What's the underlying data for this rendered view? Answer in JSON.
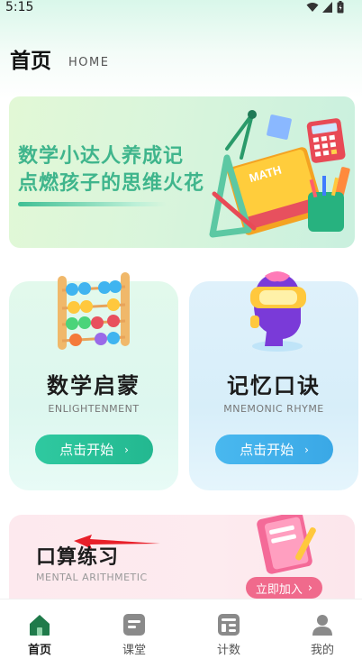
{
  "status_bar": {
    "time": "5:15"
  },
  "header": {
    "title": "首页",
    "subtitle": "HOME"
  },
  "banner": {
    "line1": "数学小达人养成记",
    "line2": "点燃孩子的思维火花",
    "book_label": "MATH"
  },
  "cards": [
    {
      "title": "数学启蒙",
      "subtitle": "ENLIGHTENMENT",
      "button": "点击开始",
      "chevron": "›"
    },
    {
      "title": "记忆口诀",
      "subtitle": "MNEMONIC RHYME",
      "button": "点击开始",
      "chevron": "›"
    }
  ],
  "practice": {
    "title": "口算练习",
    "subtitle": "MENTAL ARITHMETIC",
    "button": "立即加入",
    "chevron": "›"
  },
  "bottom_nav": {
    "items": [
      {
        "label": "首页",
        "icon": "home-icon",
        "active": true
      },
      {
        "label": "课堂",
        "icon": "classroom-icon",
        "active": false
      },
      {
        "label": "计数",
        "icon": "counting-icon",
        "active": false
      },
      {
        "label": "我的",
        "icon": "profile-icon",
        "active": false
      }
    ]
  },
  "colors": {
    "accent_green": "#2fc9a0",
    "accent_blue": "#49b8ef",
    "accent_pink": "#f06a8c",
    "nav_active": "#1f7a4a",
    "nav_inactive": "#8a8a8a"
  }
}
